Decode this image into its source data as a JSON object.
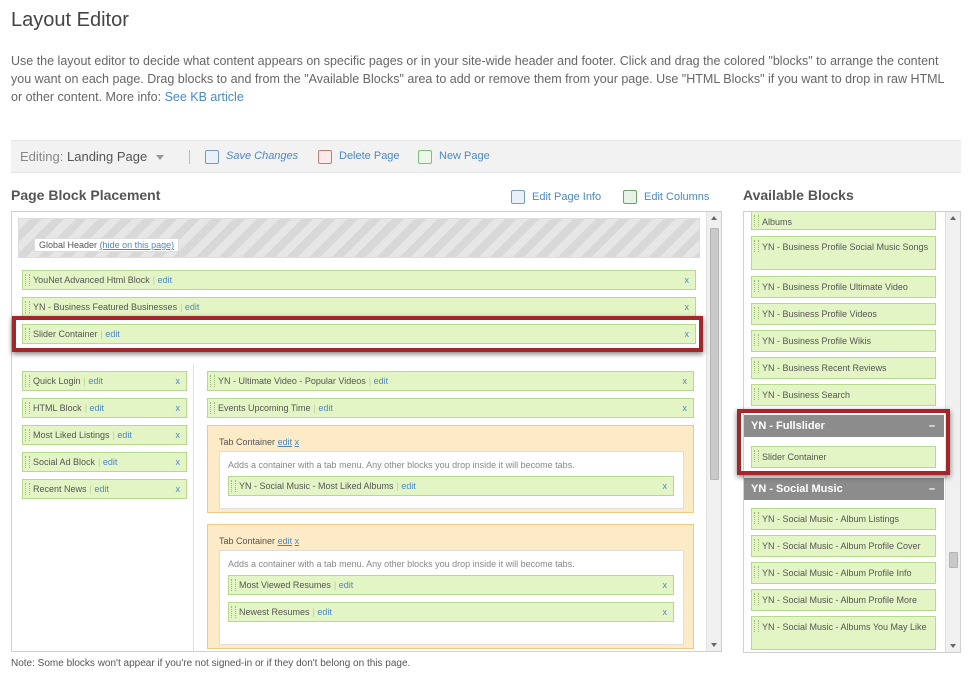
{
  "page": {
    "title": "Layout Editor",
    "intro": "Use the layout editor to decide what content appears on specific pages or in your site-wide header and footer. Click and drag the colored \"blocks\" to arrange the content you want on each page. Drag blocks to and from the \"Available Blocks\" area to add or remove them from your page. Use \"HTML Blocks\" if you want to drop in raw HTML or other content. More info: ",
    "kb_link": "See KB article",
    "note": "Note: Some blocks won't appear if you're not signed-in or if they don't belong on this page."
  },
  "toolbar": {
    "editing_label": "Editing:",
    "editing_value": "Landing Page",
    "save_label": "Save Changes",
    "delete_label": "Delete Page",
    "new_label": "New Page"
  },
  "placement": {
    "title": "Page Block Placement",
    "edit_page_info": "Edit Page Info",
    "edit_columns": "Edit Columns",
    "global_header": "Global Header",
    "hide_link": "(hide on this page)",
    "edit_label": "edit",
    "close_label": "x",
    "top_blocks": [
      "YouNet Advanced Html Block",
      "YN - Business Featured Businesses",
      "Slider Container"
    ],
    "left_blocks": [
      "Quick Login",
      "HTML Block",
      "Most Liked Listings",
      "Social Ad Block",
      "Recent News"
    ],
    "right_blocks": [
      "YN - Ultimate Video - Popular Videos",
      "Events Upcoming Time"
    ],
    "tab_container_title": "Tab Container",
    "tab_edit": "edit",
    "tab_close": "x",
    "tab_desc": "Adds a container with a tab menu. Any other blocks you drop inside it will become tabs.",
    "tab1_blocks": [
      "YN - Social Music - Most Liked Albums"
    ],
    "tab2_blocks": [
      "Most Viewed Resumes",
      "Newest Resumes"
    ]
  },
  "available": {
    "title": "Available Blocks",
    "blocks_top": [
      "Albums",
      "YN - Business Profile Social Music Songs",
      "YN - Business Profile Ultimate Video",
      "YN - Business Profile Videos",
      "YN - Business Profile Wikis",
      "YN - Business Recent Reviews",
      "YN - Business Search"
    ],
    "cat_fullslider": "YN - Fullslider",
    "cat_fullslider_blocks": [
      "Slider Container"
    ],
    "cat_social_music": "YN - Social Music",
    "cat_social_music_blocks": [
      "YN - Social Music - Album Listings",
      "YN - Social Music - Album Profile Cover",
      "YN - Social Music - Album Profile Info",
      "YN - Social Music - Album Profile More",
      "YN - Social Music - Albums You May Like"
    ],
    "collapse_symbol": "–"
  },
  "colors": {
    "block_green": "#e3f5c4",
    "tab_orange": "#fdeac7",
    "category_gray": "#8c8c8c",
    "highlight_red": "#a3262a",
    "link_blue": "#4d88c4"
  }
}
